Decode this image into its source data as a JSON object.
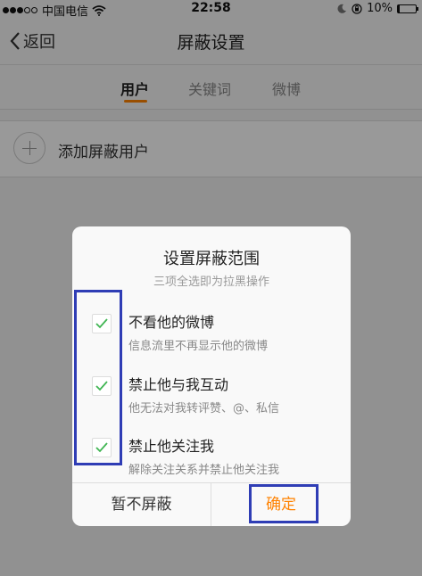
{
  "status_bar": {
    "carrier": "中国电信",
    "time": "22:58",
    "battery": "10%",
    "battery_level": 0.1
  },
  "nav": {
    "back_label": "返回",
    "title": "屏蔽设置"
  },
  "tabs": [
    {
      "label": "用户",
      "active": true
    },
    {
      "label": "关键词",
      "active": false
    },
    {
      "label": "微博",
      "active": false
    }
  ],
  "add_row": {
    "label": "添加屏蔽用户"
  },
  "dialog": {
    "title": "设置屏蔽范围",
    "subtitle": "三项全选即为拉黑操作",
    "options": [
      {
        "title": "不看他的微博",
        "desc": "信息流里不再显示他的微博",
        "checked": true
      },
      {
        "title": "禁止他与我互动",
        "desc": "他无法对我转评赞、@、私信",
        "checked": true
      },
      {
        "title": "禁止他关注我",
        "desc": "解除关注关系并禁止他关注我",
        "checked": true
      }
    ],
    "cancel_label": "暂不屏蔽",
    "confirm_label": "确定"
  },
  "colors": {
    "accent": "#ff8200",
    "check": "#3fb552",
    "highlight": "#2f3db5"
  }
}
